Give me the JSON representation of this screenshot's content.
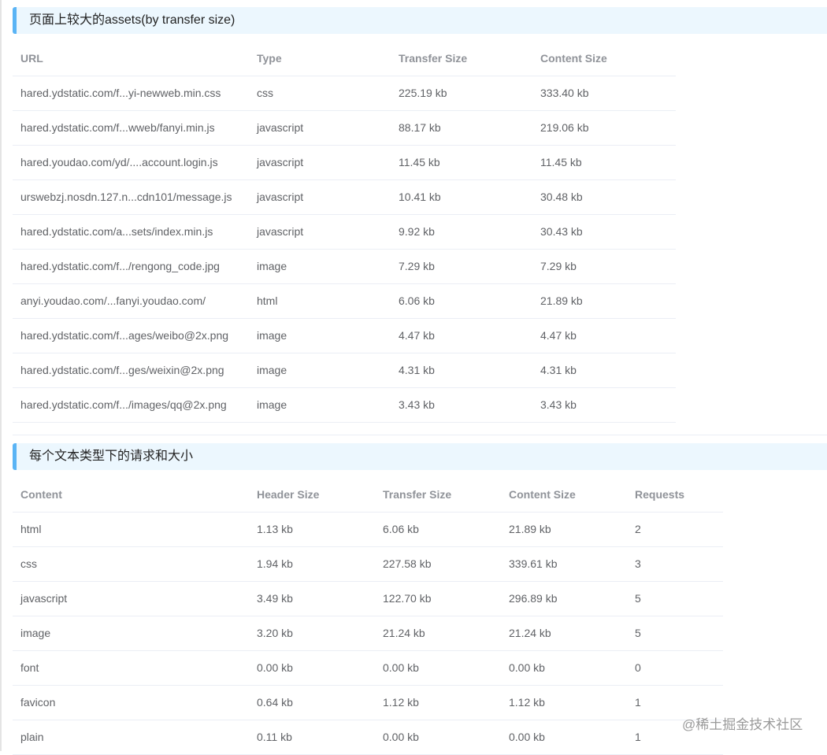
{
  "section1": {
    "title": "页面上较大的assets(by transfer size)",
    "headers": [
      "URL",
      "Type",
      "Transfer Size",
      "Content Size"
    ],
    "rows": [
      [
        "hared.ydstatic.com/f...yi-newweb.min.css",
        "css",
        "225.19 kb",
        "333.40 kb"
      ],
      [
        "hared.ydstatic.com/f...wweb/fanyi.min.js",
        "javascript",
        "88.17 kb",
        "219.06 kb"
      ],
      [
        "hared.youdao.com/yd/....account.login.js",
        "javascript",
        "11.45 kb",
        "11.45 kb"
      ],
      [
        "urswebzj.nosdn.127.n...cdn101/message.js",
        "javascript",
        "10.41 kb",
        "30.48 kb"
      ],
      [
        "hared.ydstatic.com/a...sets/index.min.js",
        "javascript",
        "9.92 kb",
        "30.43 kb"
      ],
      [
        "hared.ydstatic.com/f.../rengong_code.jpg",
        "image",
        "7.29 kb",
        "7.29 kb"
      ],
      [
        "anyi.youdao.com/...fanyi.youdao.com/",
        "html",
        "6.06 kb",
        "21.89 kb"
      ],
      [
        "hared.ydstatic.com/f...ages/weibo@2x.png",
        "image",
        "4.47 kb",
        "4.47 kb"
      ],
      [
        "hared.ydstatic.com/f...ges/weixin@2x.png",
        "image",
        "4.31 kb",
        "4.31 kb"
      ],
      [
        "hared.ydstatic.com/f.../images/qq@2x.png",
        "image",
        "3.43 kb",
        "3.43 kb"
      ]
    ]
  },
  "section2": {
    "title": "每个文本类型下的请求和大小",
    "headers": [
      "Content",
      "Header Size",
      "Transfer Size",
      "Content Size",
      "Requests"
    ],
    "rows": [
      [
        "html",
        "1.13 kb",
        "6.06 kb",
        "21.89 kb",
        "2"
      ],
      [
        "css",
        "1.94 kb",
        "227.58 kb",
        "339.61 kb",
        "3"
      ],
      [
        "javascript",
        "3.49 kb",
        "122.70 kb",
        "296.89 kb",
        "5"
      ],
      [
        "image",
        "3.20 kb",
        "21.24 kb",
        "21.24 kb",
        "5"
      ],
      [
        "font",
        "0.00 kb",
        "0.00 kb",
        "0.00 kb",
        "0"
      ],
      [
        "favicon",
        "0.64 kb",
        "1.12 kb",
        "1.12 kb",
        "1"
      ],
      [
        "plain",
        "0.11 kb",
        "0.00 kb",
        "0.00 kb",
        "1"
      ]
    ]
  },
  "watermark": "@稀土掘金技术社区"
}
